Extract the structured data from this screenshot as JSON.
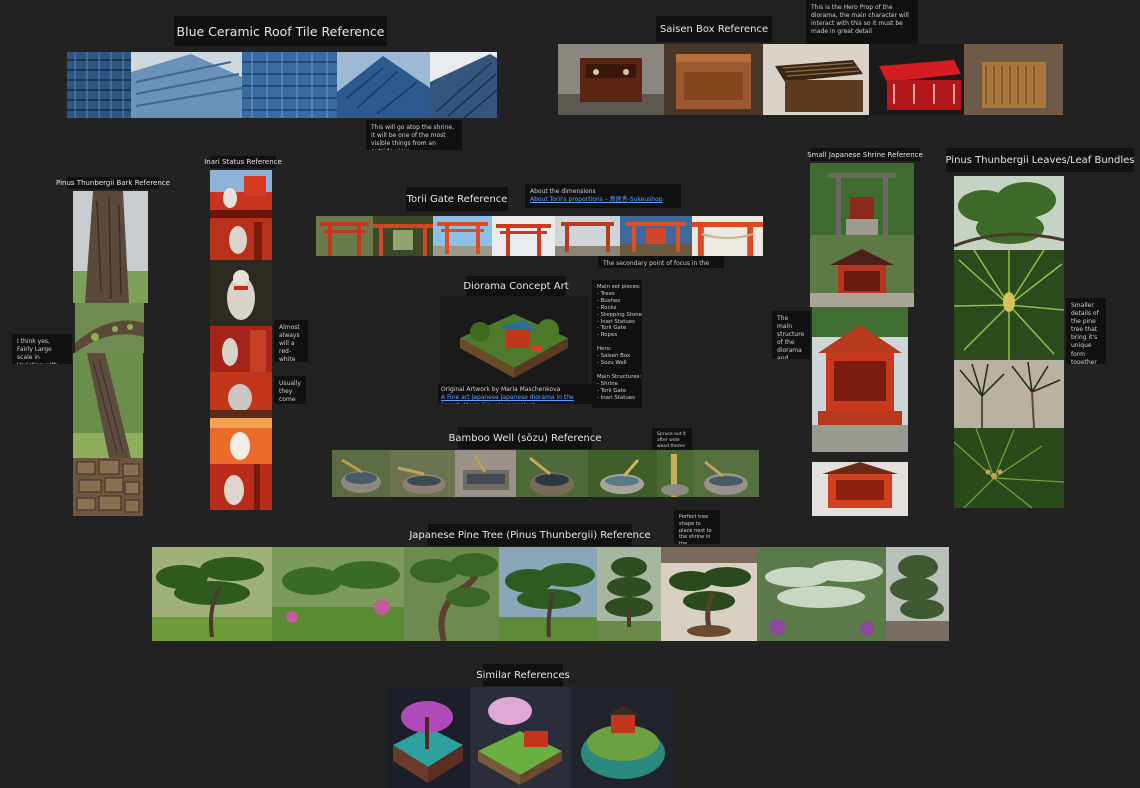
{
  "titles": {
    "roof": "Blue Ceramic Roof Tile Reference",
    "saisen": "Saisen Box Reference",
    "inari": "Inari Status Reference",
    "bark": "Pinus Thunbergii Bark Reference",
    "torii": "Torii Gate Reference",
    "shrine": "Small Japanese Shrine Reference",
    "leaves": "Pinus Thunbergii Leaves/Leaf Bundles",
    "concept": "Diorama Concept Art",
    "well": "Bamboo Well (sōzu) Reference",
    "pine": "Japanese Pine Tree (Pinus Thunbergii) Reference",
    "similar": "Similar References"
  },
  "notes": {
    "saisen_hero": "This is the Hero Prop of the diorama, the main character will interact with this so it must be made in great detail",
    "roof_note": "This will go atop the shrine, it will be one of the most visible things from an outside view",
    "torii_dims": "About the dimensions",
    "torii_link": "About Torii's proportions – 鳥居舎-Sukeushop",
    "torii_focus": "The secondary point of focus in the diorama",
    "inari_note1": "Almost always will a red-white pole of each foregery around neck",
    "inari_note2": "Usually they come in pairs, either side of the shrine",
    "bark_note": "I think yes, Fairly Large scale in Varieties with moss",
    "shrine_note": "The main structure of the diorama and main point of detail",
    "leaves_note": "Smaller details of the pine tree that bring it's unique form together",
    "well_note": "Spruce out it after wide wood theme add a sprout gloss",
    "pine_note": "Perfect tree shape to place next to the shrine in the diorama/corner of it",
    "concept_credit": "Original Artwork by Maria Maschenkova",
    "concept_link": "A Fine art Japanese Japanese diorama in the Forest, Maria Sinvelev/unsplash"
  },
  "concept_list": [
    "Main set pieces:",
    "- Trees",
    "- Bushes",
    "- Rocks",
    "- Stepping Stones",
    "- Inari Statues",
    "- Torii Gate",
    "- Ropes",
    "",
    "Hero:",
    "- Saisen Box",
    "- Sozu Well",
    "",
    "Main Structures:",
    "- Shrine",
    "- Torii Gate",
    "- Inari Statues"
  ],
  "colors": {
    "background": "#222222",
    "label_bg": "#111111",
    "link": "#5aa0ff",
    "shrine_red": "#c4361b",
    "roof_blue": "#3f6c9e",
    "pine_green": "#4e7a2c"
  }
}
